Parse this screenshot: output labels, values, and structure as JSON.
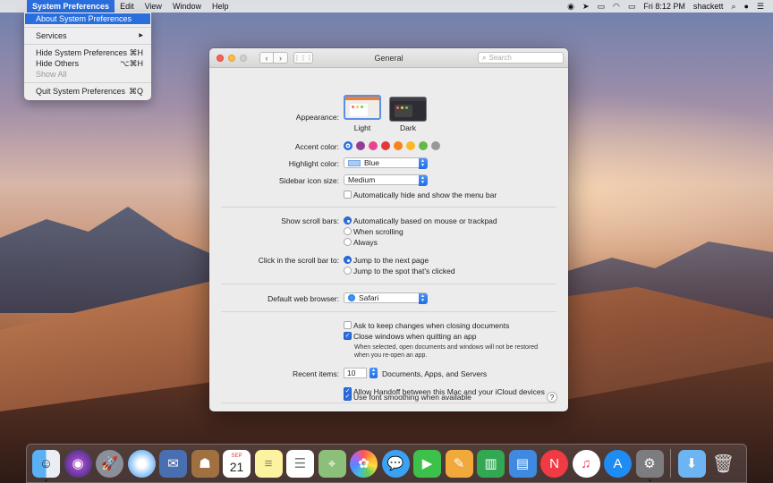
{
  "menubar": {
    "apple_glyph": "",
    "items": [
      "System Preferences",
      "Edit",
      "View",
      "Window",
      "Help"
    ],
    "clock": "Fri 8:12 PM",
    "user": "shackett",
    "status_icons": [
      "siri-menu-icon",
      "location-icon",
      "airplay-icon",
      "wifi-icon",
      "battery-icon",
      "search-icon",
      "notification-center-icon",
      "siri-icon"
    ]
  },
  "dropdown": {
    "about": "About System Preferences",
    "services": "Services",
    "services_arrow": "▶",
    "hide": "Hide System Preferences",
    "hide_shortcut": "⌘H",
    "hide_others": "Hide Others",
    "hide_others_shortcut": "⌥⌘H",
    "show_all": "Show All",
    "quit": "Quit System Preferences",
    "quit_shortcut": "⌘Q"
  },
  "window": {
    "title": "General",
    "search_placeholder": "Search"
  },
  "general": {
    "appearance_label": "Appearance:",
    "appearance_light": "Light",
    "appearance_dark": "Dark",
    "accent_label": "Accent color:",
    "accent_colors": [
      "#1f6ee8",
      "#953d96",
      "#e8438f",
      "#e0383e",
      "#f7821b",
      "#fcb827",
      "#62ba46",
      "#989898"
    ],
    "highlight_label": "Highlight color:",
    "highlight_value": "Blue",
    "sidebar_label": "Sidebar icon size:",
    "sidebar_value": "Medium",
    "auto_hide_menu": "Automatically hide and show the menu bar",
    "scrollbars_label": "Show scroll bars:",
    "scroll_auto": "Automatically based on mouse or trackpad",
    "scroll_when": "When scrolling",
    "scroll_always": "Always",
    "click_label": "Click in the scroll bar to:",
    "click_next": "Jump to the next page",
    "click_spot": "Jump to the spot that's clicked",
    "browser_label": "Default web browser:",
    "browser_value": "Safari",
    "ask_keep": "Ask to keep changes when closing documents",
    "close_windows": "Close windows when quitting an app",
    "close_note": "When selected, open documents and windows will not be restored when you re-open an app.",
    "recent_label": "Recent items:",
    "recent_value": "10",
    "recent_suffix": "Documents, Apps, and Servers",
    "handoff": "Allow Handoff between this Mac and your iCloud devices",
    "font_smoothing": "Use font smoothing when available",
    "help": "?"
  },
  "dock": {
    "calendar_month": "SEP",
    "calendar_day": "21"
  }
}
